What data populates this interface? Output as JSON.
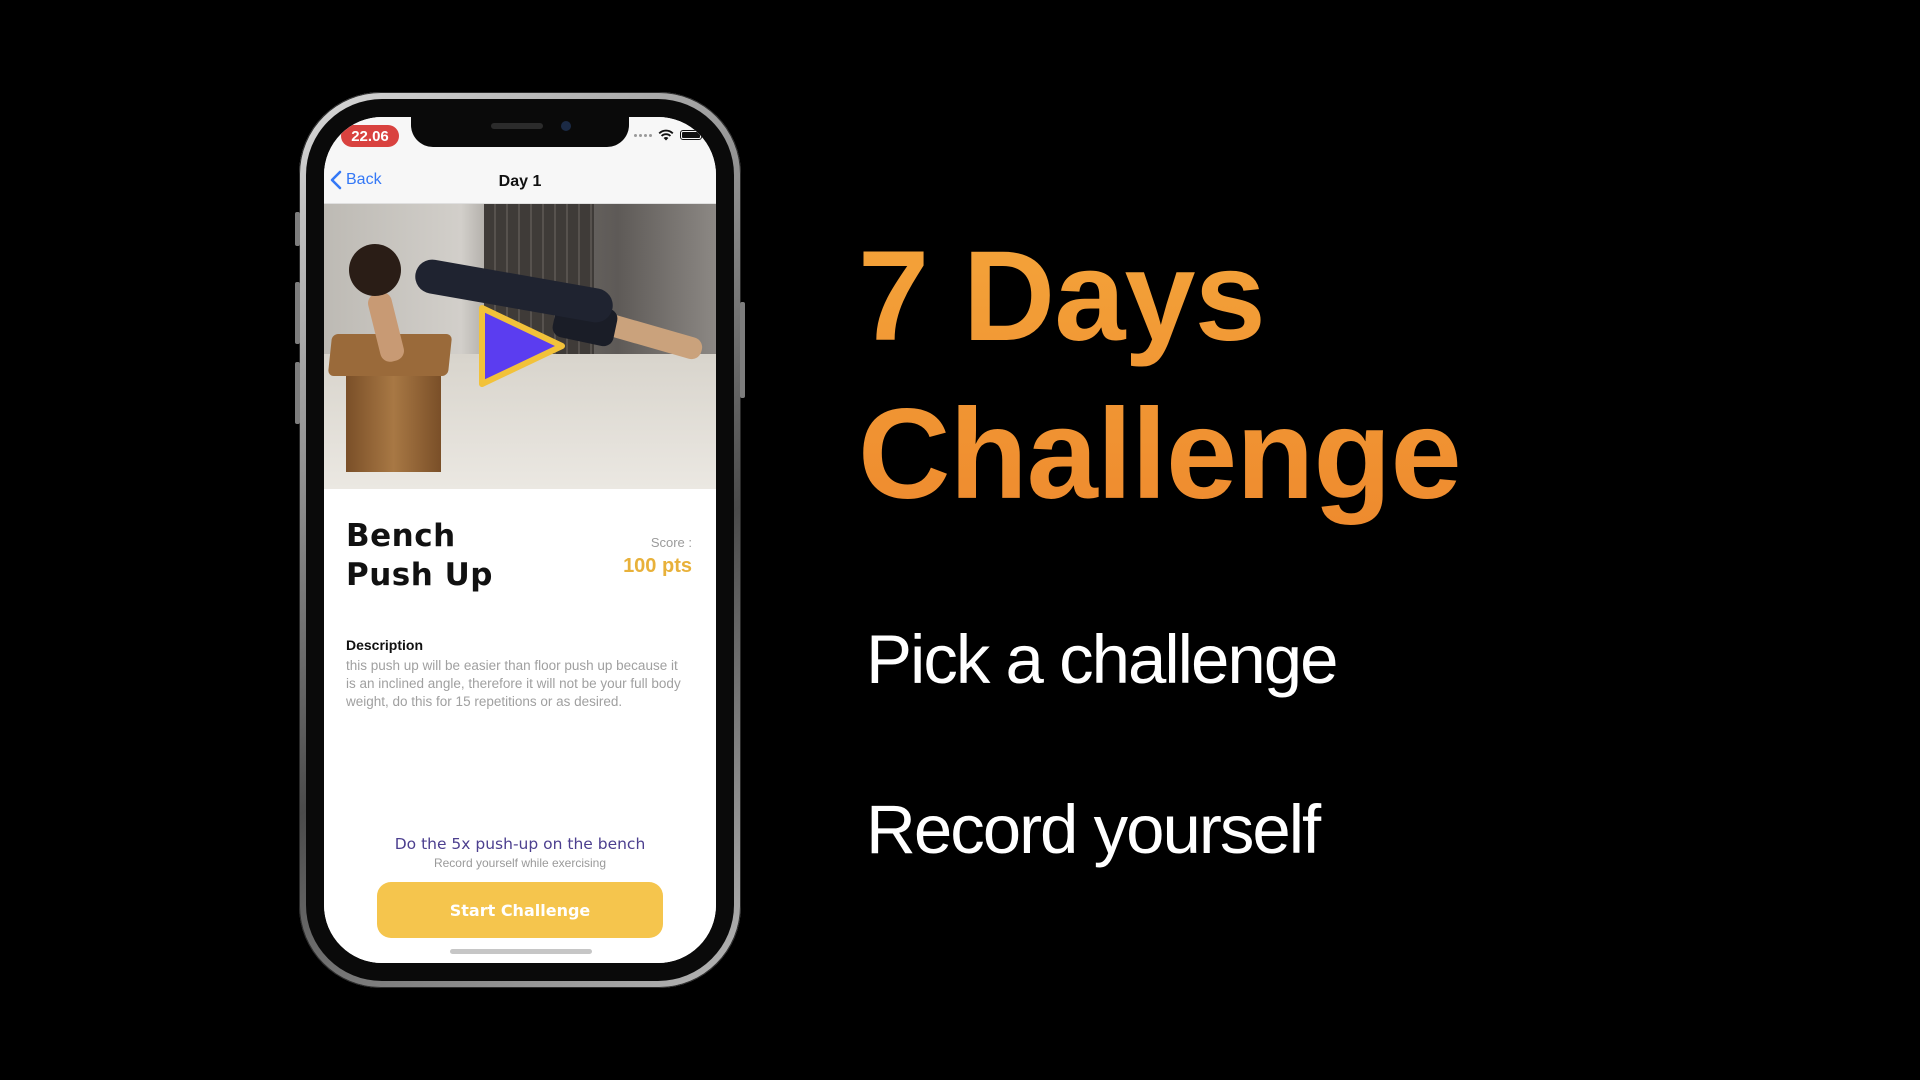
{
  "phone": {
    "status_bar": {
      "time": "22.06"
    },
    "nav": {
      "back_label": "Back",
      "title": "Day 1"
    },
    "exercise": {
      "title_line1": "Bench",
      "title_line2": "Push Up",
      "score_label": "Score :",
      "score_value": "100 pts",
      "description_heading": "Description",
      "description_text": "this push up will be easier than floor push up because it is an inclined angle, therefore it will not be your full body weight, do this for 15 repetitions or as desired."
    },
    "cta": {
      "title": "Do the 5x push-up on the bench",
      "subtitle": "Record yourself while exercising",
      "button_label": "Start Challenge"
    },
    "colors": {
      "accent_blue": "#3478f6",
      "time_pill": "#d9423f",
      "score_gold": "#e8b13a",
      "button_yellow": "#f5c54d",
      "play_purple": "#5b3df0"
    }
  },
  "promo": {
    "headline_line1": "7 Days",
    "headline_line2": "Challenge",
    "bullet1": "Pick a challenge",
    "bullet2": "Record yourself",
    "headline_color": "#f19a34"
  }
}
